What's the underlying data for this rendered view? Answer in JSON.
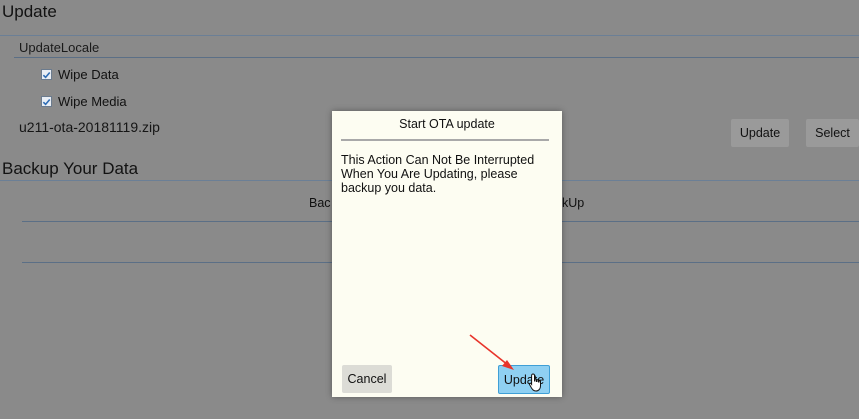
{
  "update_section": {
    "title": "Update",
    "locale_label": "UpdateLocale",
    "checkboxes": [
      {
        "label": "Wipe Data",
        "checked": true
      },
      {
        "label": "Wipe Media",
        "checked": true
      }
    ],
    "file_name": "u211-ota-20181119.zip",
    "update_button": "Update",
    "select_button": "Select"
  },
  "backup_section": {
    "title": "Backup Your Data",
    "backup_button_left": "Bac",
    "backup_button_right": "kUp"
  },
  "dialog": {
    "title": "Start OTA update",
    "message": "This Action Can Not Be Interrupted When You Are Updating, please backup you data.",
    "cancel_button": "Cancel",
    "update_button": "Update"
  },
  "colors": {
    "background": "#8a8a8a",
    "dialog_background": "#fdfdf2",
    "update_button_highlight": "#8fd0f2",
    "annotation_arrow": "#e8342b"
  }
}
